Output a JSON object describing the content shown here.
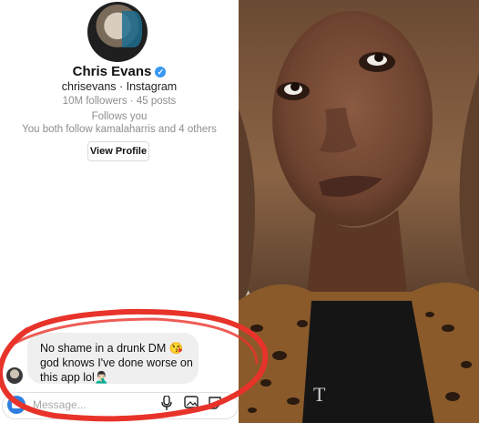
{
  "profile": {
    "name": "Chris Evans",
    "verified": true,
    "handle_line": "chrisevans · Instagram",
    "stats_line": "10M followers · 45 posts",
    "follow_status": "Follows you",
    "mutual_line": "You both follow kamalaharris and 4 others",
    "view_profile_label": "View Profile"
  },
  "message": {
    "text": "No shame in a drunk DM 😘 god knows I've done worse on this app lol🤦🏻‍♂️"
  },
  "composer": {
    "placeholder": "Message..."
  },
  "colors": {
    "verified_badge": "#3897f0",
    "annotation_red": "#e8332a",
    "camera_button": "#2f7fe0"
  },
  "icons": [
    "camera-icon",
    "microphone-icon",
    "gallery-icon",
    "sticker-icon",
    "verified-badge-icon"
  ]
}
